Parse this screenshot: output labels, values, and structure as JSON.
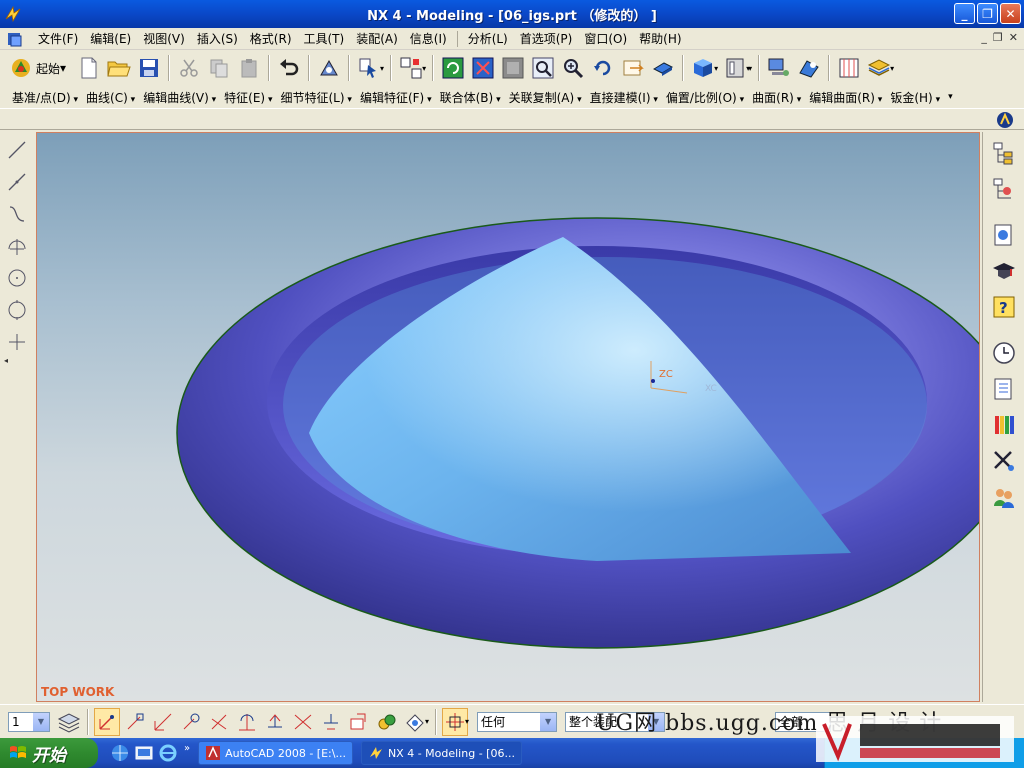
{
  "window": {
    "title": "NX 4 - Modeling - [06_igs.prt （修改的） ]",
    "minimize": "_",
    "restore": "❐",
    "close": "✕"
  },
  "menubar": {
    "items": [
      "文件(F)",
      "编辑(E)",
      "视图(V)",
      "插入(S)",
      "格式(R)",
      "工具(T)",
      "装配(A)",
      "信息(I)",
      "分析(L)",
      "首选项(P)",
      "窗口(O)",
      "帮助(H)"
    ],
    "mdi_min": "_",
    "mdi_restore": "❐",
    "mdi_close": "✕"
  },
  "toolbar1": {
    "start_label": "起始"
  },
  "toolbar2": {
    "items": [
      "基准/点(D)",
      "曲线(C)",
      "编辑曲线(V)",
      "特征(E)",
      "细节特征(L)",
      "编辑特征(F)",
      "联合体(B)",
      "关联复制(A)",
      "直接建模(I)",
      "偏置/比例(O)",
      "曲面(R)",
      "编辑曲面(R)",
      "钣金(H)"
    ]
  },
  "viewport": {
    "view_label": "TOP WORK",
    "triad": {
      "zc": "ZC",
      "xc": "XC"
    }
  },
  "bottombar": {
    "layer_value": "1",
    "filter_value": "任何",
    "scope_value": "整个装配",
    "mode_value": "全部",
    "watermark": "UG网 bbs.ugg.com 思 月 设 计"
  },
  "taskbar": {
    "start_label": "开始",
    "tasks": [
      {
        "label": "AutoCAD 2008 - [E:\\...",
        "active": false
      },
      {
        "label": "NX 4 - Modeling - [06...",
        "active": true
      }
    ],
    "more": "»"
  },
  "colors": {
    "title_blue": "#0a48c8",
    "dish_outer": "#5454c8",
    "dish_face": "#6fb4f0",
    "view_label": "#e06030"
  }
}
